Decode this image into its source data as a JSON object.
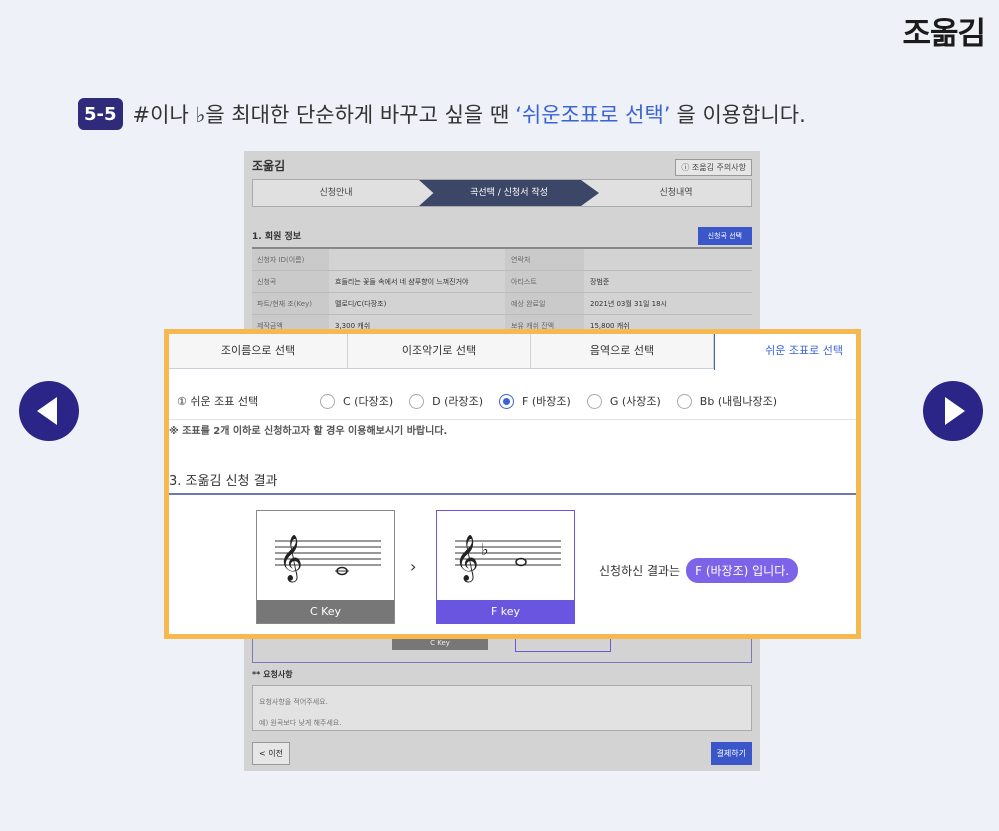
{
  "brand": "조옮김",
  "headline": {
    "step": "5-5",
    "before": "#이나 ♭을 최대한 단순하게 바꾸고 싶을 땐",
    "highlight": "‘쉬운조표로 선택’",
    "after": "을 이용합니다."
  },
  "background_screen": {
    "title": "조옮김",
    "notice_button": "ⓘ 조옮김 주의사항",
    "steps": [
      "신청안내",
      "곡선택 / 신청서 작성",
      "신청내역"
    ],
    "section_title": "1. 회원 정보",
    "section_button": "신청곡 선택",
    "info_rows": [
      {
        "k1": "신청자 ID(이름)",
        "v1": "",
        "k2": "연락처",
        "v2": ""
      },
      {
        "k1": "신청곡",
        "v1": "흐들리는 꽃들 속에서 네 샴푸향이 느껴진거야",
        "k2": "아티스트",
        "v2": "장범준"
      },
      {
        "k1": "파트/현재 조(Key)",
        "v1": "멜로디/C(다장조)",
        "k2": "예상 완료일",
        "v2": "2021년 03월 31일 18시"
      },
      {
        "k1": "제작금액",
        "v1": "3,300 캐쉬",
        "k2": "보유 캐쉬 잔액",
        "v2": "15,800 캐쉬"
      }
    ],
    "ckey_label": "C Key",
    "request_title": "** 요청사항",
    "request_placeholder_1": "요청사항을 적어주세요.",
    "request_placeholder_2": "예) 원곡보다 낮게 해주세요.",
    "prev_button": "< 이전",
    "pay_button": "결제하기"
  },
  "panel": {
    "tabs": [
      {
        "label": "조이름으로 선택",
        "active": false
      },
      {
        "label": "이조악기로 선택",
        "active": false
      },
      {
        "label": "음역으로 선택",
        "active": false
      },
      {
        "label": "쉬운 조표로 선택",
        "active": true
      }
    ],
    "key_row_label": "① 쉬운 조표 선택",
    "options": [
      {
        "label": "C (다장조)",
        "selected": false
      },
      {
        "label": "D (라장조)",
        "selected": false
      },
      {
        "label": "F (바장조)",
        "selected": true
      },
      {
        "label": "G (사장조)",
        "selected": false
      },
      {
        "label": "Bb (내림나장조)",
        "selected": false
      }
    ],
    "note": "※ 조표를 2개 이하로 신청하고자 할 경우 이용해보시기 바랍니다.",
    "result_title": "3. 조옮김 신청 결과",
    "from_key": "C Key",
    "to_key": "F key",
    "arrow": "›",
    "result_prefix": "신청하신 결과는",
    "result_value": "F (바장조) 입니다."
  },
  "colors": {
    "accent": "#3b63d6",
    "highlight_border": "#f7b850",
    "nav_circle": "#2a2586",
    "f_key": "#6a55e0"
  }
}
